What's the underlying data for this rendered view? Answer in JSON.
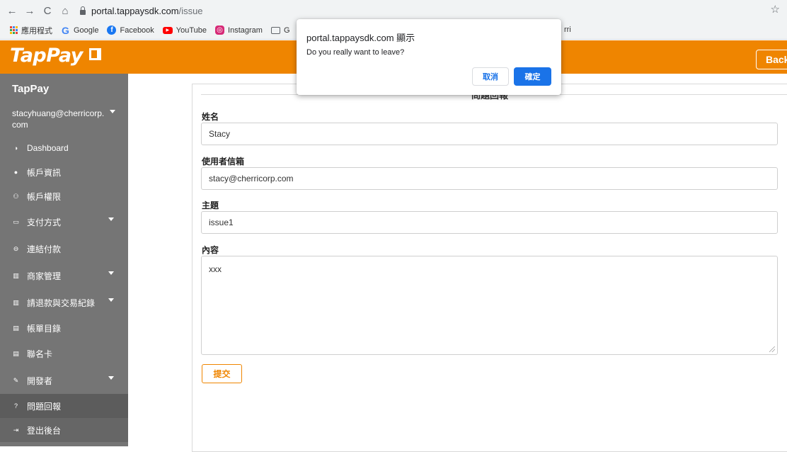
{
  "browser": {
    "nav": {
      "back_icon": "←",
      "forward_icon": "→",
      "reload_icon": "C",
      "home_icon": "⌂"
    },
    "url_host": "portal.tappaysdk.com",
    "url_path": "/issue",
    "star_icon": "☆",
    "bookmarks": [
      {
        "label": "應用程式",
        "icon": "apps-icon"
      },
      {
        "label": "Google",
        "icon": "google-icon"
      },
      {
        "label": "Facebook",
        "icon": "facebook-icon"
      },
      {
        "label": "YouTube",
        "icon": "youtube-icon"
      },
      {
        "label": "Instagram",
        "icon": "instagram-icon"
      },
      {
        "label": "G",
        "icon": "folder-icon"
      }
    ],
    "bookmark_tail": "rri"
  },
  "header": {
    "logo_text": "TapPay",
    "back_label": "Back",
    "color": "#ef8500"
  },
  "sidebar": {
    "brand": "TapPay",
    "user": "stacyhuang@cherricorp.com",
    "items": [
      {
        "label": "Dashboard",
        "icon": "◑"
      },
      {
        "label": "帳戶資訊",
        "icon": "●"
      },
      {
        "label": "帳戶權限",
        "icon": "⚇"
      },
      {
        "label": "支付方式",
        "icon": "▭"
      },
      {
        "label": "連結付款",
        "icon": "⊖"
      },
      {
        "label": "商家管理",
        "icon": "▥"
      },
      {
        "label": "請退款與交易紀錄",
        "icon": "▥"
      },
      {
        "label": "帳單目錄",
        "icon": "▤"
      },
      {
        "label": "聯名卡",
        "icon": "▤"
      },
      {
        "label": "開發者",
        "icon": "✎"
      },
      {
        "label": "問題回報",
        "icon": "?"
      },
      {
        "label": "登出後台",
        "icon": "⇥"
      }
    ]
  },
  "form": {
    "legend": "問題回報",
    "name_label": "姓名",
    "name_value": "Stacy",
    "email_label": "使用者信箱",
    "email_value": "stacy@cherricorp.com",
    "subject_label": "主題",
    "subject_value": "issue1",
    "content_label": "內容",
    "content_value": "xxx",
    "submit_label": "提交"
  },
  "dialog": {
    "title": "portal.tappaysdk.com 顯示",
    "message": "Do you really want to leave?",
    "cancel_label": "取消",
    "ok_label": "確定"
  }
}
